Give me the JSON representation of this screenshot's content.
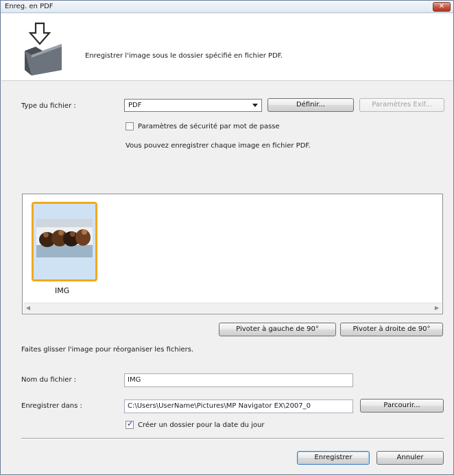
{
  "window": {
    "title": "Enreg. en PDF",
    "close_label": "✕"
  },
  "header": {
    "description": "Enregistrer l'image sous le dossier spécifié en fichier PDF."
  },
  "file_type": {
    "label": "Type du fichier :",
    "value": "PDF",
    "define_button": "Définir...",
    "exif_button": "Paramètres Exif..."
  },
  "password_security": {
    "label": "Paramètres de sécurité par mot de passe",
    "checked": false
  },
  "info_text": "Vous pouvez enregistrer chaque image en fichier PDF.",
  "thumbnails": [
    {
      "label": "IMG",
      "selected": true
    }
  ],
  "rotate": {
    "left": "Pivoter à gauche de 90°",
    "right": "Pivoter à droite de 90°"
  },
  "drag_hint": "Faites glisser l'image pour réorganiser les fichiers.",
  "filename": {
    "label": "Nom du fichier :",
    "value": "IMG"
  },
  "save_in": {
    "label": "Enregistrer dans :",
    "value": "C:\\Users\\UserName\\Pictures\\MP Navigator EX\\2007_0",
    "browse_button": "Parcourir..."
  },
  "create_folder": {
    "label": "Créer un dossier pour la date du jour",
    "checked": true
  },
  "footer": {
    "save_button": "Enregistrer",
    "cancel_button": "Annuler"
  },
  "colors": {
    "selection": "#f0a81e",
    "close": "#c75a43",
    "default_focus": "#3b7ac6"
  }
}
